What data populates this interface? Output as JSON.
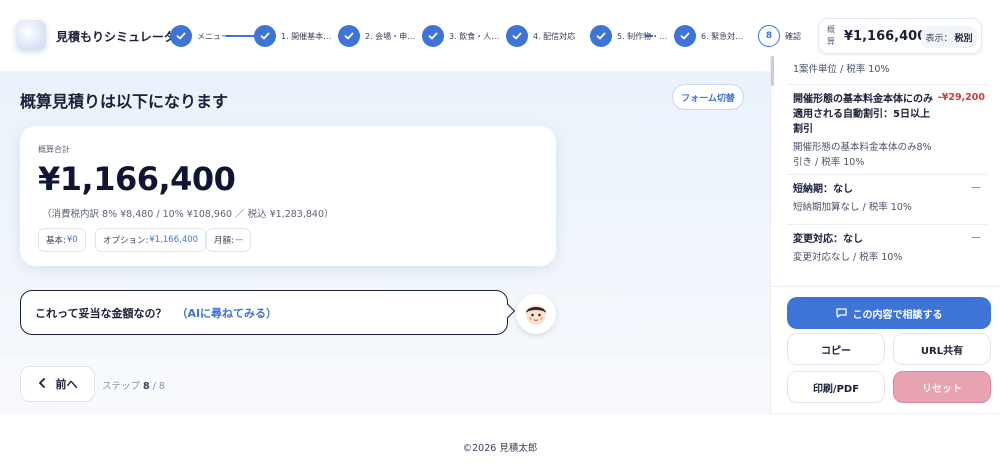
{
  "app": {
    "title": "見積もりシミュレーター"
  },
  "steps": [
    {
      "label": "メニュー",
      "done": true
    },
    {
      "label": "1. 開催基本…",
      "done": true
    },
    {
      "label": "2. 会場・申…",
      "done": true
    },
    {
      "label": "3. 飲食・人…",
      "done": true
    },
    {
      "label": "4. 配信対応",
      "done": true
    },
    {
      "label": "5. 制作物・…",
      "done": true
    },
    {
      "label": "6. 緊急対…",
      "done": true
    },
    {
      "number": "8",
      "label": "確認",
      "current": true
    }
  ],
  "header_total": {
    "label": "概算",
    "amount": "¥1,166,400",
    "tax_label": "表示：",
    "tax_value": "税別"
  },
  "main": {
    "title": "概算見積りは以下になります",
    "form_toggle": "フォーム切替",
    "card": {
      "label": "概算合計",
      "amount": "¥1,166,400",
      "breakdown": "（消費税内訳 8% ¥8,480 / 10% ¥108,960 ／ 税込 ¥1,283,840）",
      "chips": [
        {
          "label": "基本:",
          "value": "¥0"
        },
        {
          "label": "オプション:",
          "value": "¥1,166,400"
        },
        {
          "label": "月額:",
          "value": "—"
        }
      ]
    },
    "bubble": {
      "question": "これって妥当な金額なの？",
      "ai_link": "（AIに尋ねてみる）"
    }
  },
  "nav": {
    "back": "前へ",
    "step_prefix": "ステップ",
    "step_current": "8",
    "step_total": "/ 8"
  },
  "sidebar": {
    "items": [
      {
        "title": "",
        "desc": "1案件単位 / 税率 10%",
        "amount": ""
      },
      {
        "title": "開催形態の基本料金本体にのみ適用される自動割引：5日以上割引",
        "desc": "開催形態の基本料金本体のみ8%引き / 税率 10%",
        "amount": "-¥29,200"
      },
      {
        "title": "短納期：なし",
        "desc": "短納期加算なし / 税率 10%",
        "amount": "—"
      },
      {
        "title": "変更対応：なし",
        "desc": "変更対応なし / 税率 10%",
        "amount": "—"
      }
    ],
    "actions": {
      "consult": "この内容で相談する",
      "copy": "コピー",
      "url": "URL共有",
      "print": "印刷/PDF",
      "reset": "リセット"
    }
  },
  "footer": {
    "text": "©2026 見積太郎"
  },
  "colors": {
    "accent": "#3e74d8",
    "reset": "#e8a3b3",
    "discount": "#d13b3b"
  }
}
